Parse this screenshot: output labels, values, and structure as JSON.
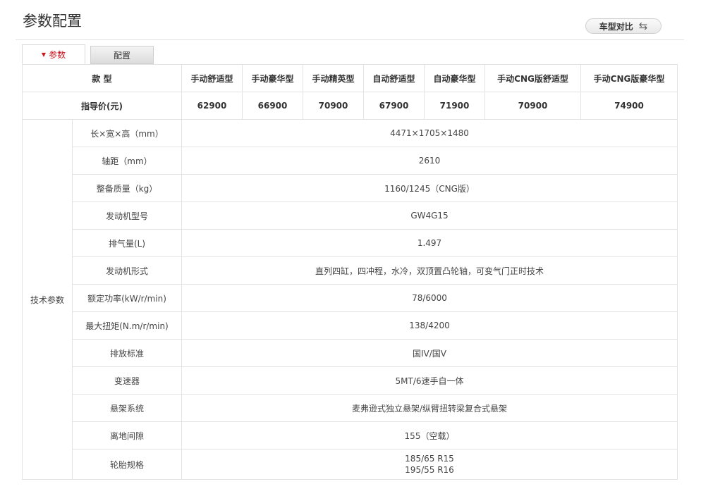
{
  "page": {
    "title": "参数配置"
  },
  "compare": {
    "label": "车型对比",
    "icon": "swap-arrows-icon"
  },
  "tabs": [
    {
      "label": "参数",
      "active": true
    },
    {
      "label": "配置",
      "active": false
    }
  ],
  "table": {
    "model_header": "款 型",
    "models": [
      "手动舒适型",
      "手动豪华型",
      "手动精英型",
      "自动舒适型",
      "自动豪华型",
      "手动CNG版舒适型",
      "手动CNG版豪华型"
    ],
    "price_header": "指导价(元)",
    "prices": [
      "62900",
      "66900",
      "70900",
      "67900",
      "71900",
      "70900",
      "74900"
    ],
    "group_label": "技术参数",
    "specs": [
      {
        "label": "长×宽×高（mm）",
        "value": "4471×1705×1480"
      },
      {
        "label": "轴距（mm）",
        "value": "2610"
      },
      {
        "label": "整备质量（kg）",
        "value": "1160/1245（CNG版）"
      },
      {
        "label": "发动机型号",
        "value": "GW4G15"
      },
      {
        "label": "排气量(L)",
        "value": "1.497"
      },
      {
        "label": "发动机形式",
        "value": "直列四缸，四冲程，水冷，双顶置凸轮轴，可变气门正时技术"
      },
      {
        "label": "额定功率(kW/r/min)",
        "value": "78/6000"
      },
      {
        "label": "最大扭矩(N.m/r/min)",
        "value": "138/4200"
      },
      {
        "label": "排放标准",
        "value": "国IV/国V"
      },
      {
        "label": "变速器",
        "value": "5MT/6速手自一体"
      },
      {
        "label": "悬架系统",
        "value": "麦弗逊式独立悬架/纵臂扭转梁复合式悬架"
      },
      {
        "label": "离地间隙",
        "value": "155（空载）"
      }
    ],
    "tyre": {
      "label": "轮胎规格",
      "values": [
        "185/65 R15",
        "195/55 R16"
      ]
    }
  }
}
